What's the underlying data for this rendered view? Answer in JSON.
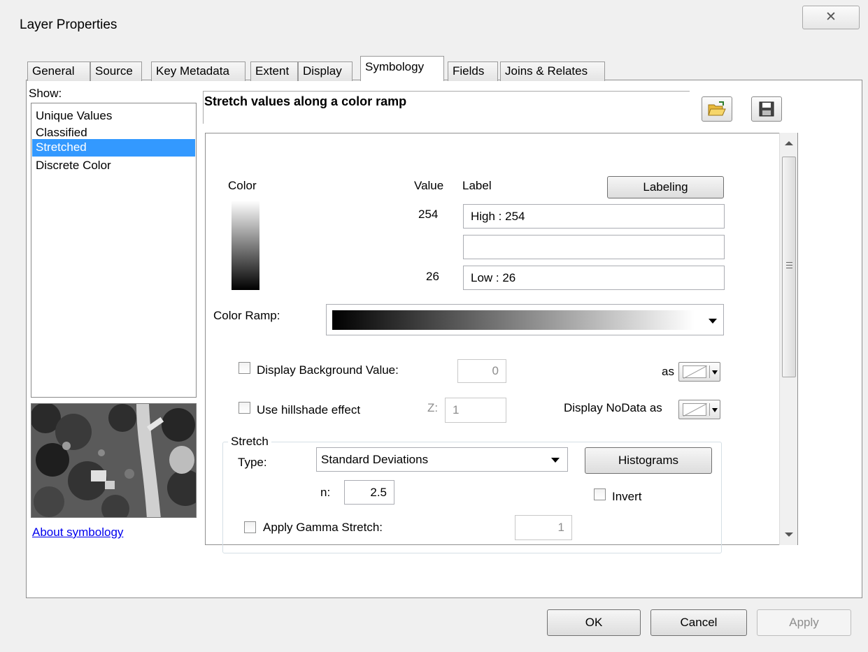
{
  "window": {
    "title": "Layer Properties",
    "close_glyph": "✕"
  },
  "tabs": [
    {
      "label": "General"
    },
    {
      "label": "Source"
    },
    {
      "label": "Key Metadata"
    },
    {
      "label": "Extent"
    },
    {
      "label": "Display"
    },
    {
      "label": "Symbology"
    },
    {
      "label": "Fields"
    },
    {
      "label": "Joins & Relates"
    }
  ],
  "active_tab": "Symbology",
  "show": {
    "label": "Show:",
    "items": [
      {
        "label": "Unique Values"
      },
      {
        "label": "Classified"
      },
      {
        "label": "Stretched"
      },
      {
        "label": "Discrete Color"
      }
    ],
    "selected": "Stretched"
  },
  "about_link": "About symbology",
  "heading": "Stretch values along a color ramp",
  "toolbar": {
    "open_icon": "folder-open-icon",
    "save_icon": "save-icon"
  },
  "legend": {
    "color_header": "Color",
    "value_header": "Value",
    "label_header": "Label",
    "labeling_button": "Labeling",
    "high_value": "254",
    "high_label": "High : 254",
    "mid_label": "",
    "low_value": "26",
    "low_label": "Low : 26"
  },
  "color_ramp": {
    "label": "Color Ramp:",
    "start_color": "#000000",
    "end_color": "#ffffff"
  },
  "background": {
    "label": "Display Background Value:",
    "value": "0",
    "as_label": "as",
    "checked": false
  },
  "hillshade": {
    "label": "Use hillshade effect",
    "z_label": "Z:",
    "z_value": "1",
    "nodata_label": "Display NoData as",
    "checked": false
  },
  "stretch": {
    "group_label": "Stretch",
    "type_label": "Type:",
    "type_value": "Standard Deviations",
    "histograms_button": "Histograms",
    "n_label": "n:",
    "n_value": "2.5",
    "invert_label": "Invert",
    "invert_checked": false,
    "gamma_label": "Apply Gamma Stretch:",
    "gamma_value": "1",
    "gamma_checked": false
  },
  "buttons": {
    "ok": "OK",
    "cancel": "Cancel",
    "apply": "Apply"
  },
  "colors": {
    "selection": "#3399ff",
    "link": "#0000ee"
  }
}
